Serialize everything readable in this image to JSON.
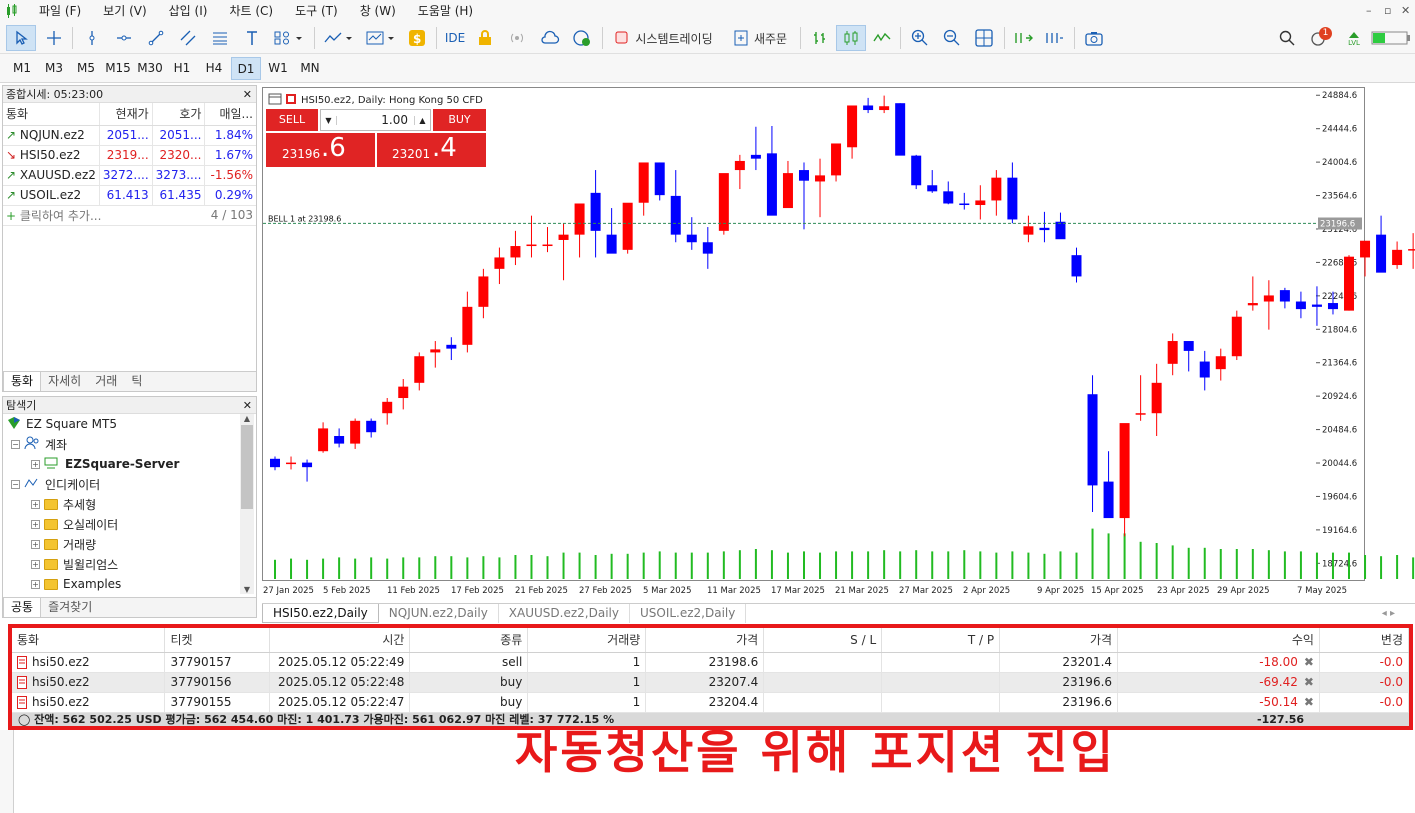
{
  "menu": [
    "파일 (F)",
    "보기 (V)",
    "삽입 (I)",
    "차트 (C)",
    "도구 (T)",
    "창 (W)",
    "도움말 (H)"
  ],
  "toolbar": {
    "ide": "IDE",
    "system_trading": "시스템트레이딩",
    "new_order": "새주문",
    "notification_count": "1",
    "lvl": "LVL"
  },
  "timeframes": [
    "M1",
    "M3",
    "M5",
    "M15",
    "M30",
    "H1",
    "H4",
    "D1",
    "W1",
    "MN"
  ],
  "active_timeframe": "D1",
  "market_watch": {
    "title": "종합시세: 05:23:00",
    "headers": [
      "통화",
      "현재가",
      "호가",
      "매일..."
    ],
    "rows": [
      {
        "symbol": "NQJUN.ez2",
        "bid": "2051...",
        "ask": "2051...",
        "change": "1.84%",
        "dir": "up"
      },
      {
        "symbol": "HSI50.ez2",
        "bid": "2319...",
        "ask": "2320...",
        "change": "1.67%",
        "dir": "down"
      },
      {
        "symbol": "XAUUSD.ez2",
        "bid": "3272....",
        "ask": "3273....",
        "change": "-1.56%",
        "dir": "up"
      },
      {
        "symbol": "USOIL.ez2",
        "bid": "61.413",
        "ask": "61.435",
        "change": "0.29%",
        "dir": "up"
      }
    ],
    "add_label": "클릭하여 추가...",
    "count": "4 / 103",
    "tabs": [
      "통화",
      "자세히",
      "거래",
      "틱"
    ]
  },
  "navigator": {
    "title": "탐색기",
    "root": "EZ Square MT5",
    "account": "계좌",
    "server": "EZSquare-Server",
    "indicators": "인디케이터",
    "folders": [
      "추세형",
      "오실레이터",
      "거래량",
      "빌윌리엄스",
      "Examples"
    ],
    "tabs": [
      "공통",
      "즐겨찾기"
    ]
  },
  "chart": {
    "title": "HSI50.ez2, Daily:  Hong Kong 50 CFD",
    "sell_label": "SELL",
    "buy_label": "BUY",
    "lot": "1.00",
    "sell_big": "23196",
    "sell_frac": ".6",
    "buy_big": "23201",
    "buy_frac": ".4",
    "position_line_label": "BELL 1 at 23198.6",
    "current_price_label": "23196.6",
    "tabs": [
      "HSI50.ez2,Daily",
      "NQJUN.ez2,Daily",
      "XAUUSD.ez2,Daily",
      "USOIL.ez2,Daily"
    ]
  },
  "chart_data": {
    "type": "candlestick",
    "y_ticks": [
      "24884.6",
      "24444.6",
      "24004.6",
      "23564.6",
      "23124.6",
      "22684.6",
      "22244.6",
      "21804.6",
      "21364.6",
      "20924.6",
      "20484.6",
      "20044.6",
      "19604.6",
      "19164.6",
      "18724.6"
    ],
    "x_labels": [
      "27 Jan 2025",
      "5 Feb 2025",
      "11 Feb 2025",
      "17 Feb 2025",
      "21 Feb 2025",
      "27 Feb 2025",
      "5 Mar 2025",
      "11 Mar 2025",
      "17 Mar 2025",
      "21 Mar 2025",
      "27 Mar 2025",
      "2 Apr 2025",
      "9 Apr 2025",
      "15 Apr 2025",
      "23 Apr 2025",
      "29 Apr 2025",
      "7 May 2025"
    ],
    "ylim": [
      18505,
      24980
    ],
    "position_price": 23198.6,
    "current_price": 23196.6,
    "colors": {
      "bull": "#ff0000",
      "bear": "#0000ff",
      "volume": "#22bb22",
      "line": "#2e8b57"
    },
    "candles": [
      [
        20100,
        20130,
        19950,
        19990
      ],
      [
        20040,
        20130,
        19960,
        20050
      ],
      [
        20050,
        20090,
        19800,
        19990
      ],
      [
        20200,
        20580,
        20180,
        20500
      ],
      [
        20400,
        20500,
        20250,
        20300
      ],
      [
        20300,
        20630,
        20230,
        20600
      ],
      [
        20600,
        20630,
        20380,
        20450
      ],
      [
        20700,
        20900,
        20550,
        20850
      ],
      [
        20900,
        21150,
        20750,
        21050
      ],
      [
        21100,
        21500,
        21000,
        21450
      ],
      [
        21500,
        21650,
        21300,
        21540
      ],
      [
        21600,
        21700,
        21400,
        21550
      ],
      [
        21600,
        22300,
        21500,
        22100
      ],
      [
        22100,
        22600,
        21950,
        22500
      ],
      [
        22600,
        22880,
        22400,
        22750
      ],
      [
        22750,
        23100,
        22650,
        22900
      ],
      [
        22900,
        23300,
        22750,
        22920
      ],
      [
        22920,
        23150,
        22820,
        22920
      ],
      [
        22980,
        23200,
        22450,
        23050
      ],
      [
        23050,
        23450,
        22750,
        23460
      ],
      [
        23600,
        23900,
        22750,
        23100
      ],
      [
        23050,
        23400,
        22850,
        22800
      ],
      [
        22850,
        23250,
        22800,
        23470
      ],
      [
        23470,
        23950,
        23300,
        24000
      ],
      [
        24000,
        24000,
        23500,
        23570
      ],
      [
        23560,
        23900,
        22950,
        23050
      ],
      [
        23050,
        23280,
        22850,
        22950
      ],
      [
        22950,
        23150,
        22600,
        22800
      ],
      [
        23100,
        23650,
        23050,
        23860
      ],
      [
        23900,
        24100,
        23650,
        24020
      ],
      [
        24100,
        24470,
        23900,
        24050
      ],
      [
        24120,
        24480,
        23700,
        23300
      ],
      [
        23400,
        24020,
        23600,
        23860
      ],
      [
        23900,
        24000,
        23120,
        23760
      ],
      [
        23750,
        24050,
        23280,
        23830
      ],
      [
        23830,
        24100,
        23750,
        24250
      ],
      [
        24200,
        24600,
        24050,
        24750
      ],
      [
        24750,
        24850,
        24650,
        24690
      ],
      [
        24690,
        24880,
        24650,
        24740
      ],
      [
        24780,
        24780,
        24100,
        24090
      ],
      [
        24090,
        24100,
        23650,
        23700
      ],
      [
        23700,
        23900,
        23600,
        23620
      ],
      [
        23620,
        23750,
        23450,
        23460
      ],
      [
        23460,
        23600,
        23380,
        23440
      ],
      [
        23440,
        23700,
        23250,
        23500
      ],
      [
        23500,
        23900,
        23300,
        23800
      ],
      [
        23800,
        24000,
        23200,
        23250
      ],
      [
        23050,
        23300,
        22950,
        23160
      ],
      [
        23140,
        23350,
        22950,
        23110
      ],
      [
        23220,
        23340,
        23100,
        22990
      ],
      [
        22780,
        22880,
        22420,
        22500
      ],
      [
        20950,
        21200,
        19400,
        19750
      ],
      [
        19800,
        20200,
        19350,
        19320
      ],
      [
        19320,
        20500,
        19080,
        20570
      ],
      [
        20700,
        21200,
        20600,
        20700
      ],
      [
        20700,
        21350,
        20400,
        21100
      ],
      [
        21350,
        21750,
        21200,
        21650
      ],
      [
        21650,
        21600,
        21250,
        21520
      ],
      [
        21380,
        21520,
        21000,
        21170
      ],
      [
        21280,
        21550,
        21130,
        21450
      ],
      [
        21450,
        22050,
        21400,
        21970
      ],
      [
        22120,
        22500,
        22050,
        22150
      ],
      [
        22170,
        22450,
        21800,
        22250
      ],
      [
        22320,
        22350,
        22080,
        22170
      ],
      [
        22170,
        22300,
        21950,
        22070
      ],
      [
        22130,
        22370,
        21850,
        22100
      ],
      [
        22150,
        22300,
        22000,
        22070
      ],
      [
        22050,
        22780,
        22050,
        22760
      ],
      [
        22750,
        22860,
        22500,
        22970
      ],
      [
        23050,
        23300,
        22650,
        22550
      ],
      [
        22650,
        22960,
        22600,
        22850
      ],
      [
        22860,
        23070,
        22600,
        22860
      ],
      [
        23200,
        23300,
        23080,
        23250
      ]
    ],
    "volumes": [
      1.6,
      1.7,
      1.6,
      1.7,
      1.8,
      1.7,
      1.8,
      1.7,
      1.8,
      1.8,
      1.9,
      1.9,
      1.8,
      1.9,
      1.8,
      2.0,
      2.0,
      1.9,
      2.2,
      2.2,
      2.0,
      2.1,
      2.1,
      2.2,
      2.3,
      2.2,
      2.2,
      2.2,
      2.3,
      2.4,
      2.5,
      2.4,
      2.2,
      2.3,
      2.2,
      2.3,
      2.3,
      2.3,
      2.4,
      2.3,
      2.4,
      2.3,
      2.3,
      2.4,
      2.3,
      2.2,
      2.3,
      2.2,
      2.1,
      2.3,
      2.2,
      4.2,
      3.8,
      3.8,
      3.1,
      3.0,
      2.8,
      2.6,
      2.6,
      2.5,
      2.5,
      2.5,
      2.4,
      2.3,
      2.3,
      2.2,
      2.2,
      2.2,
      2.0,
      1.9,
      2.0,
      1.8,
      0.2
    ]
  },
  "trade": {
    "headers": [
      "통화",
      "티켓",
      "시간",
      "종류",
      "거래량",
      "가격",
      "S / L",
      "T / P",
      "가격",
      "수익",
      "변경"
    ],
    "rows": [
      {
        "symbol": "hsi50.ez2",
        "ticket": "37790157",
        "time": "2025.05.12 05:22:49",
        "type": "sell",
        "volume": "1",
        "open": "23198.6",
        "sl": "",
        "tp": "",
        "price": "23201.4",
        "profit": "-18.00",
        "change": "-0.0"
      },
      {
        "symbol": "hsi50.ez2",
        "ticket": "37790156",
        "time": "2025.05.12 05:22:48",
        "type": "buy",
        "volume": "1",
        "open": "23207.4",
        "sl": "",
        "tp": "",
        "price": "23196.6",
        "profit": "-69.42",
        "change": "-0.0"
      },
      {
        "symbol": "hsi50.ez2",
        "ticket": "37790155",
        "time": "2025.05.12 05:22:47",
        "type": "buy",
        "volume": "1",
        "open": "23204.4",
        "sl": "",
        "tp": "",
        "price": "23196.6",
        "profit": "-50.14",
        "change": "-0.0"
      }
    ],
    "balance_line": "잔액: 562 502.25 USD  평가금: 562 454.60  마진: 1 401.73  가용마진: 561 062.97  마진 레벨: 37 772.15 %",
    "total_profit": "-127.56"
  },
  "caption": "자동청산을 위해 포지션 진입"
}
